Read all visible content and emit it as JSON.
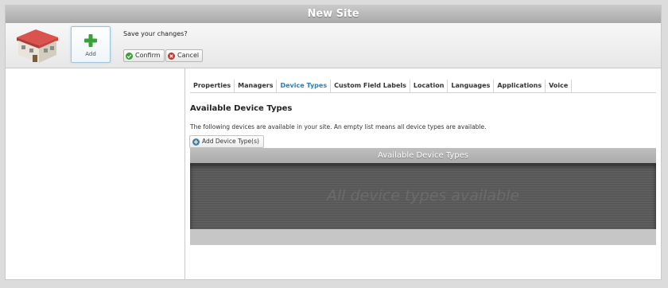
{
  "window": {
    "title": "New Site"
  },
  "toolbar": {
    "add_label": "Add",
    "save_prompt": "Save your changes?",
    "confirm_label": "Confirm",
    "cancel_label": "Cancel"
  },
  "tabs": [
    {
      "label": "Properties"
    },
    {
      "label": "Managers"
    },
    {
      "label": "Device Types",
      "active": true
    },
    {
      "label": "Custom Field Labels"
    },
    {
      "label": "Location"
    },
    {
      "label": "Languages"
    },
    {
      "label": "Applications"
    },
    {
      "label": "Voice"
    }
  ],
  "content": {
    "title": "Available Device Types",
    "description": "The following devices are available in your site. An empty list means all device types are available.",
    "add_button_label": "Add Device Type(s)",
    "panel_title": "Available Device Types",
    "empty_message": "All device types available"
  },
  "colors": {
    "accent": "#2a7fb8",
    "confirm_green": "#3aa13a",
    "cancel_red": "#c0392b",
    "add_blue": "#3d7fb3"
  }
}
